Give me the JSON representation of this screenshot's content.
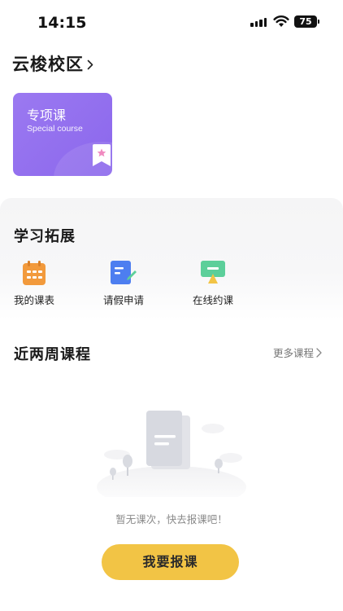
{
  "status_bar": {
    "time": "14:15",
    "battery": "75"
  },
  "campus": {
    "name": "云梭校区"
  },
  "special_course": {
    "title": "专项课",
    "subtitle": "Special course"
  },
  "extension": {
    "title": "学习拓展",
    "items": [
      {
        "label": "我的课表",
        "icon": "calendar-icon",
        "color": "#f29a3c"
      },
      {
        "label": "请假申请",
        "icon": "leave-request-icon",
        "color": "#4d7ef0"
      },
      {
        "label": "在线约课",
        "icon": "online-booking-icon",
        "color": "#5ccf9a"
      }
    ]
  },
  "recent": {
    "title": "近两周课程",
    "more_label": "更多课程",
    "empty_text": "暂无课次，快去报课吧！"
  },
  "enroll_button": {
    "label": "我要报课",
    "color": "#f2c445"
  }
}
